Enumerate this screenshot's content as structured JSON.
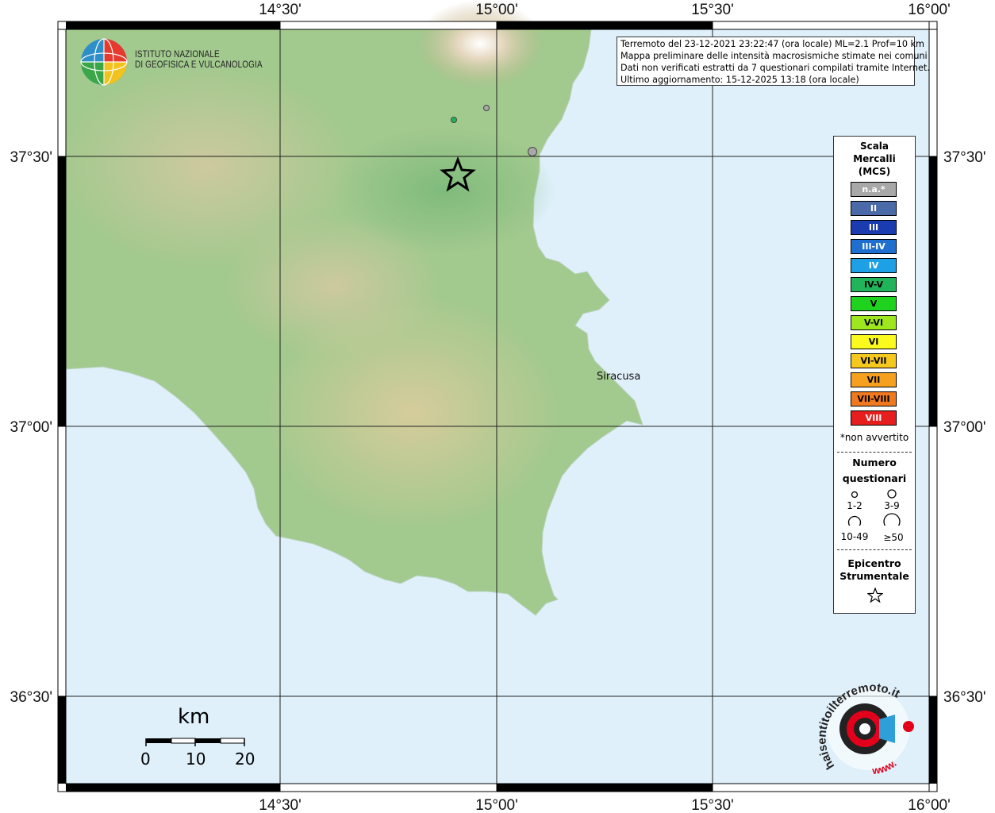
{
  "info": {
    "line1": "Terremoto del 23-12-2021 23:22:47 (ora locale) ML=2.1 Prof=10 km",
    "line2": "Mappa preliminare delle intensità macrosismiche stimate nei comuni",
    "line3": "Dati non verificati estratti da 7 questionari compilati tramite Internet.",
    "line4": "Ultimo aggiornamento: 15-12-2025 13:18 (ora locale)"
  },
  "logo": {
    "line1": "ISTITUTO NAZIONALE",
    "line2": "DI GEOFISICA E VULCANOLOGIA"
  },
  "axis": {
    "top": [
      "14°30'",
      "15°00'",
      "15°30'",
      "16°00'"
    ],
    "bottom": [
      "14°30'",
      "15°00'",
      "15°30'",
      "16°00'"
    ],
    "left": [
      "37°30'",
      "37°00'",
      "36°30'"
    ],
    "right": [
      "37°30'",
      "37°00'",
      "36°30'"
    ]
  },
  "place": {
    "name": "Siracusa"
  },
  "legend": {
    "title_line1": "Scala",
    "title_line2": "Mercalli",
    "title_line3": "(MCS)",
    "scale": [
      {
        "label": "n.a.*",
        "color": "#a8a8a8",
        "text": "#ffffff"
      },
      {
        "label": "II",
        "color": "#4a6aa8",
        "text": "#ffffff"
      },
      {
        "label": "III",
        "color": "#1a3cb0",
        "text": "#ffffff"
      },
      {
        "label": "III-IV",
        "color": "#1e6fd0",
        "text": "#ffffff"
      },
      {
        "label": "IV",
        "color": "#1ea0e6",
        "text": "#ffffff"
      },
      {
        "label": "IV-V",
        "color": "#22b45a",
        "text": "#000000"
      },
      {
        "label": "V",
        "color": "#1ed21e",
        "text": "#000000"
      },
      {
        "label": "V-VI",
        "color": "#9ee61e",
        "text": "#000000"
      },
      {
        "label": "VI",
        "color": "#fafa1e",
        "text": "#000000"
      },
      {
        "label": "VI-VII",
        "color": "#f5c81e",
        "text": "#000000"
      },
      {
        "label": "VII",
        "color": "#f5a01e",
        "text": "#000000"
      },
      {
        "label": "VII-VIII",
        "color": "#f0781e",
        "text": "#000000"
      },
      {
        "label": "VIII",
        "color": "#e61e1e",
        "text": "#ffffff"
      }
    ],
    "note": "*non avvertito",
    "count_title_line1": "Numero",
    "count_title_line2": "questionari",
    "sizes": [
      "1-2",
      "3-9",
      "10-49",
      "≥50"
    ],
    "epi_title_line1": "Epicentro",
    "epi_title_line2": "Strumentale"
  },
  "scalebar": {
    "unit": "km",
    "labels": [
      "0",
      "10",
      "20"
    ]
  },
  "watermark": {
    "text": "haisentitoilterremoto.it",
    "url": "www."
  },
  "colors": {
    "sea": "#dff0fb",
    "land": "#9cc98c",
    "grid": "#222222",
    "epicenter_star": "#000000"
  }
}
